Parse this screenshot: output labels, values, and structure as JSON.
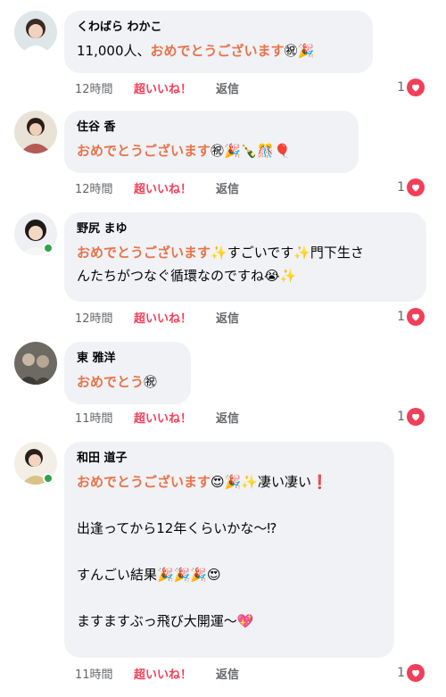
{
  "comments": [
    {
      "author": "くわばら わかこ",
      "lines": [
        {
          "plain": "11,000人、",
          "highlight": "おめでとうございます",
          "emoji": "㊗🎉"
        }
      ],
      "time": "12時間",
      "reaction_label": "超いいね！",
      "reply_label": "返信",
      "like_count": "1",
      "online": false
    },
    {
      "author": "住谷 香",
      "lines": [
        {
          "plain": "",
          "highlight": "おめでとうございます",
          "emoji": "㊗🎉🍾🎊🎈"
        }
      ],
      "time": "12時間",
      "reaction_label": "超いいね！",
      "reply_label": "返信",
      "like_count": "1",
      "online": false
    },
    {
      "author": "野尻 まゆ",
      "lines": [
        {
          "plain": "",
          "highlight": "おめでとうございます",
          "emoji": "✨",
          "tail": "すごいです✨門下生さ"
        },
        {
          "plain": "んたちがつなぐ循環なのですね😭✨",
          "highlight": "",
          "emoji": ""
        }
      ],
      "time": "12時間",
      "reaction_label": "超いいね！",
      "reply_label": "返信",
      "like_count": "1",
      "online": true
    },
    {
      "author": "東 雅洋",
      "lines": [
        {
          "plain": "",
          "highlight": "おめでとう",
          "emoji": "㊗"
        }
      ],
      "time": "11時間",
      "reaction_label": "超いいね！",
      "reply_label": "返信",
      "like_count": "1",
      "online": false
    },
    {
      "author": "和田 道子",
      "lines": [
        {
          "plain": "",
          "highlight": "おめでとうございます",
          "emoji": "😍🎉✨",
          "tail": "凄い凄い❗"
        },
        {
          "plain": "",
          "highlight": "",
          "emoji": ""
        },
        {
          "plain": "出逢ってから12年くらいかな〜⁉",
          "highlight": "",
          "emoji": ""
        },
        {
          "plain": "",
          "highlight": "",
          "emoji": ""
        },
        {
          "plain": "すんごい結果🎉🎉🎉😍",
          "highlight": "",
          "emoji": ""
        },
        {
          "plain": "",
          "highlight": "",
          "emoji": ""
        },
        {
          "plain": "ますますぶっ飛び大開運〜💖",
          "highlight": "",
          "emoji": ""
        }
      ],
      "time": "11時間",
      "reaction_label": "超いいね！",
      "reply_label": "返信",
      "like_count": "1",
      "online": true
    }
  ],
  "colors": {
    "highlight": "#e8734a",
    "reaction": "#f33e58",
    "online": "#31a24c",
    "bubble": "#f0f2f5"
  },
  "icons": {
    "like": "heart-icon"
  }
}
